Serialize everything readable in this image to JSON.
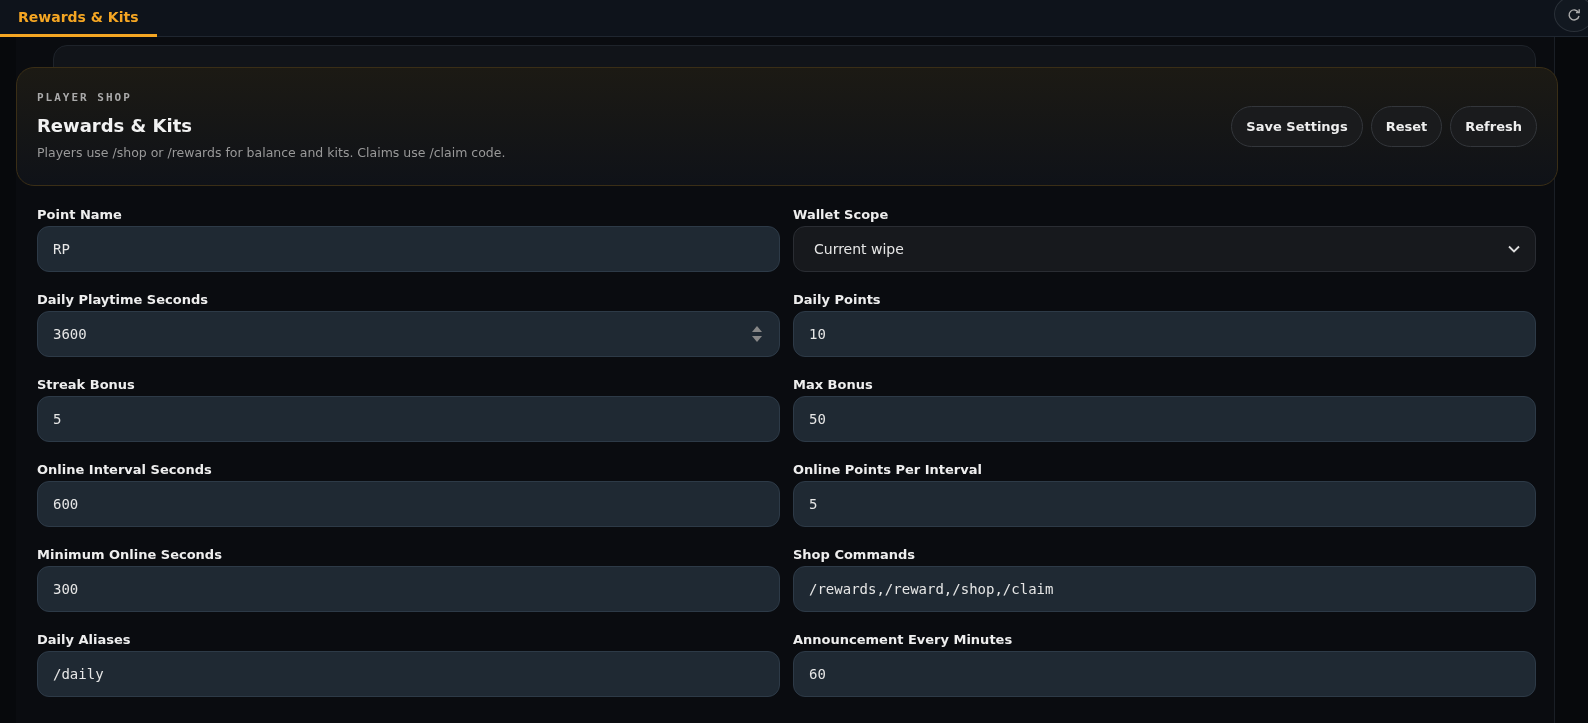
{
  "tabs": [
    {
      "label": "Rewards & Kits",
      "selected": true
    }
  ],
  "header": {
    "eyebrow": "PLAYER SHOP",
    "title": "Rewards & Kits",
    "description": "Players use /shop or /rewards for balance and kits. Claims use /claim code.",
    "buttons": [
      "Save Settings",
      "Reset",
      "Refresh"
    ]
  },
  "fields": [
    {
      "label": "Point Name",
      "kind": "text",
      "value": "RP"
    },
    {
      "label": "Wallet Scope",
      "kind": "select",
      "value": "Current wipe"
    },
    {
      "label": "Daily Playtime Seconds",
      "kind": "spin",
      "value": "3600"
    },
    {
      "label": "Daily Points",
      "kind": "text",
      "value": "10"
    },
    {
      "label": "Streak Bonus",
      "kind": "text",
      "value": "5"
    },
    {
      "label": "Max Bonus",
      "kind": "text",
      "value": "50"
    },
    {
      "label": "Online Interval Seconds",
      "kind": "text",
      "value": "600"
    },
    {
      "label": "Online Points Per Interval",
      "kind": "text",
      "value": "5"
    },
    {
      "label": "Minimum Online Seconds",
      "kind": "text",
      "value": "300"
    },
    {
      "label": "Shop Commands",
      "kind": "text",
      "value": "/rewards,/reward,/shop,/claim"
    },
    {
      "label": "Daily Aliases",
      "kind": "text",
      "value": "/daily"
    },
    {
      "label": "Announcement Every Minutes",
      "kind": "text",
      "value": "60"
    }
  ]
}
